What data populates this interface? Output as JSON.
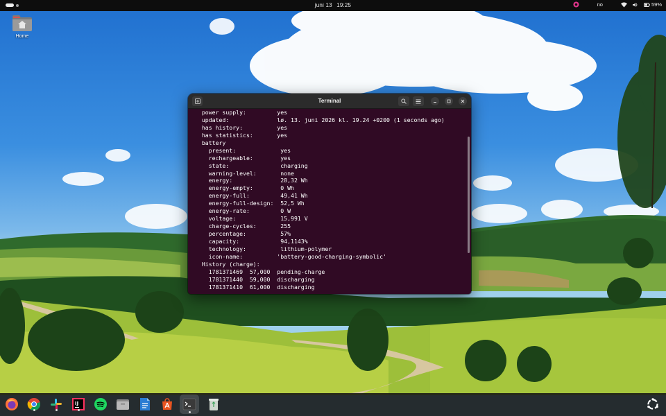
{
  "topbar": {
    "date": "juni 13",
    "time": "19:25",
    "keyboard_layout": "no",
    "battery_percent": "59%",
    "icons": [
      "activities-pill",
      "notification-app-icon",
      "wifi-icon",
      "volume-icon",
      "battery-icon"
    ]
  },
  "desktop": {
    "icons": [
      {
        "label": "Home",
        "icon": "home-folder-icon"
      }
    ]
  },
  "terminal": {
    "title": "Terminal",
    "header_icons": [
      "new-tab-icon",
      "search-icon",
      "hamburger-menu-icon",
      "minimize-icon",
      "maximize-icon",
      "close-icon"
    ],
    "lines": [
      "  power supply:         yes",
      "  updated:              lø. 13. juni 2026 kl. 19.24 +0200 (1 seconds ago)",
      "  has history:          yes",
      "  has statistics:       yes",
      "  battery",
      "    present:             yes",
      "    rechargeable:        yes",
      "    state:               charging",
      "    warning-level:       none",
      "    energy:              28,32 Wh",
      "    energy-empty:        0 Wh",
      "    energy-full:         49,41 Wh",
      "    energy-full-design:  52,5 Wh",
      "    energy-rate:         0 W",
      "    voltage:             15,991 V",
      "    charge-cycles:       255",
      "    percentage:          57%",
      "    capacity:            94,1143%",
      "    technology:          lithium-polymer",
      "    icon-name:          'battery-good-charging-symbolic'",
      "  History (charge):",
      "    1781371469  57,000  pending-charge",
      "    1781371440  59,000  discharging",
      "    1781371410  61,000  discharging"
    ]
  },
  "dock": {
    "items": [
      {
        "name": "Firefox",
        "icon": "firefox-icon"
      },
      {
        "name": "Google Chrome",
        "icon": "chrome-icon"
      },
      {
        "name": "Slack",
        "icon": "slack-icon"
      },
      {
        "name": "IntelliJ IDEA",
        "icon": "intellij-icon"
      },
      {
        "name": "Spotify",
        "icon": "spotify-icon"
      },
      {
        "name": "Files",
        "icon": "files-icon"
      },
      {
        "name": "LibreOffice Writer",
        "icon": "writer-icon"
      },
      {
        "name": "App Center",
        "icon": "app-center-icon"
      },
      {
        "name": "Terminal",
        "icon": "terminal-icon"
      },
      {
        "name": "Trash",
        "icon": "trash-icon"
      },
      {
        "name": "Show Apps",
        "icon": "show-apps-icon"
      }
    ]
  },
  "colors": {
    "terminal_bg": "#300a24",
    "topbar_bg": "#0d0d0d",
    "dock_bg": "#141414"
  }
}
